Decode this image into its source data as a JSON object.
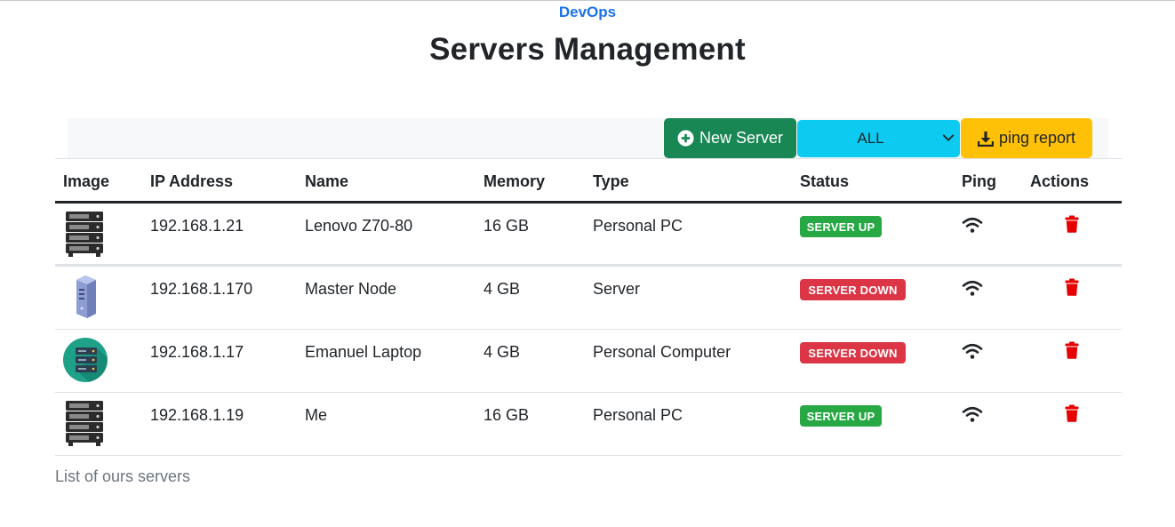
{
  "header": {
    "brand": "DevOps",
    "title": "Servers Management"
  },
  "toolbar": {
    "new_server_label": "New Server",
    "filter_value": "ALL",
    "ping_report_label": "ping report"
  },
  "table": {
    "columns": [
      "Image",
      "IP Address",
      "Name",
      "Memory",
      "Type",
      "Status",
      "Ping",
      "Actions"
    ],
    "rows": [
      {
        "image": "server-rack",
        "ip": "192.168.1.21",
        "name": "Lenovo Z70-80",
        "memory": "16 GB",
        "type": "Personal PC",
        "status": "SERVER UP"
      },
      {
        "image": "server-tower",
        "ip": "192.168.1.170",
        "name": "Master Node",
        "memory": "4 GB",
        "type": "Server",
        "status": "SERVER DOWN"
      },
      {
        "image": "server-circle",
        "ip": "192.168.1.17",
        "name": "Emanuel Laptop",
        "memory": "4 GB",
        "type": "Personal Computer",
        "status": "SERVER DOWN"
      },
      {
        "image": "server-rack",
        "ip": "192.168.1.19",
        "name": "Me",
        "memory": "16 GB",
        "type": "Personal PC",
        "status": "SERVER UP"
      }
    ],
    "caption": "List of ours servers"
  },
  "colors": {
    "success": "#198754",
    "info": "#0dcaf0",
    "warning": "#ffc107",
    "badge_up": "#28a745",
    "badge_down": "#dc3545",
    "delete": "#e60000",
    "brand": "#1a73e8"
  },
  "icons": {
    "new_server": "plus-circle-icon",
    "ping_report": "download-icon",
    "filter": "chevron-down-icon",
    "ping": "wifi-icon",
    "delete": "trash-icon"
  }
}
